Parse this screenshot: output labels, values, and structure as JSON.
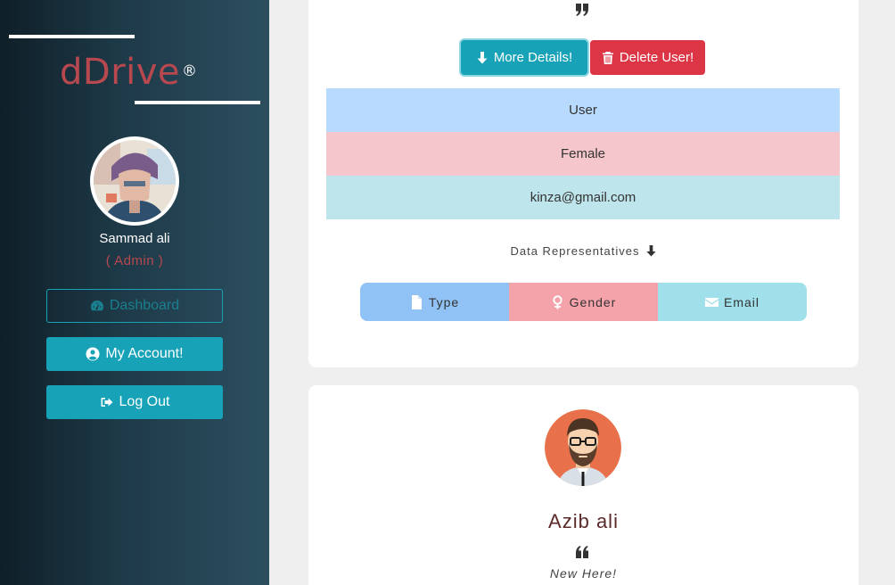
{
  "sidebar": {
    "brand": "dDrive",
    "brand_mark": "®",
    "user_name": "Sammad ali",
    "user_role": "( Admin )",
    "buttons": {
      "dashboard": {
        "label": "Dashboard",
        "icon": "tachometer-icon"
      },
      "account": {
        "label": "My Account!",
        "icon": "user-circle-icon"
      },
      "logout": {
        "label": "Log Out",
        "icon": "sign-out-icon"
      }
    }
  },
  "card1": {
    "actions": {
      "more_details": "More Details!",
      "delete_user": "Delete User!"
    },
    "rows": {
      "type": "User",
      "gender": "Female",
      "email": "kinza@gmail.com"
    },
    "data_rep_label": "Data Representatives",
    "legend": {
      "type": "Type",
      "gender": "Gender",
      "email": "Email"
    }
  },
  "card2": {
    "name": "Azib ali",
    "bio": "New Here!"
  },
  "colors": {
    "brand": "#b8484f",
    "info": "#17a2b8",
    "danger": "#dc3545",
    "row_type": "#b8daff",
    "row_gender": "#f5c6cb",
    "row_email": "#bee5eb"
  }
}
